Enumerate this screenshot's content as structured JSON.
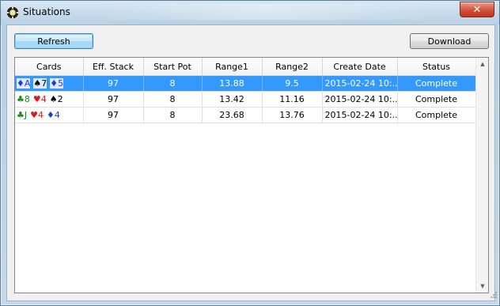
{
  "window": {
    "title": "Situations",
    "close_glyph": "✕"
  },
  "toolbar": {
    "refresh_label": "Refresh",
    "download_label": "Download"
  },
  "table": {
    "columns": [
      "Cards",
      "Eff. Stack",
      "Start Pot",
      "Range1",
      "Range2",
      "Create Date",
      "Status"
    ],
    "rows": [
      {
        "cards": [
          {
            "suit": "♦",
            "rank": "A",
            "color": "diamond"
          },
          {
            "suit": "♠",
            "rank": "7",
            "color": "spade"
          },
          {
            "suit": "♦",
            "rank": "5",
            "color": "diamond"
          }
        ],
        "eff_stack": "97",
        "start_pot": "8",
        "range1": "13.88",
        "range2": "9.5",
        "create_date": "2015-02-24 10:...",
        "status": "Complete",
        "selected": true
      },
      {
        "cards": [
          {
            "suit": "♣",
            "rank": "8",
            "color": "club"
          },
          {
            "suit": "♥",
            "rank": "4",
            "color": "heart"
          },
          {
            "suit": "♠",
            "rank": "2",
            "color": "spade"
          }
        ],
        "eff_stack": "97",
        "start_pot": "8",
        "range1": "13.42",
        "range2": "11.16",
        "create_date": "2015-02-24 10:...",
        "status": "Complete",
        "selected": false
      },
      {
        "cards": [
          {
            "suit": "♣",
            "rank": "J",
            "color": "club"
          },
          {
            "suit": "♥",
            "rank": "4",
            "color": "heart"
          },
          {
            "suit": "♦",
            "rank": "4",
            "color": "diamond"
          }
        ],
        "eff_stack": "97",
        "start_pot": "8",
        "range1": "23.68",
        "range2": "13.76",
        "create_date": "2015-02-24 10:...",
        "status": "Complete",
        "selected": false
      }
    ]
  },
  "colors": {
    "selection": "#3399ff",
    "club": "#1a8a1a",
    "heart": "#e01818",
    "spade": "#000000",
    "diamond": "#1a3be0"
  },
  "icons": {
    "app": "poker-chip-icon",
    "close": "close-icon",
    "scroll_up": "scroll-up-icon",
    "scroll_down": "scroll-down-icon"
  }
}
